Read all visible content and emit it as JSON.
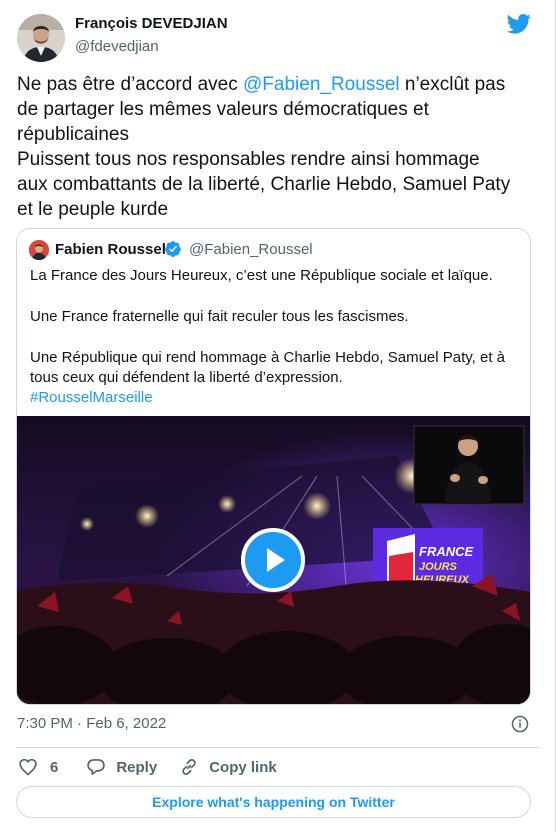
{
  "author": {
    "name": "François DEVEDJIAN",
    "handle": "@fdevedjian"
  },
  "tweet": {
    "line1_before": "Ne pas être d’accord avec ",
    "mention": "@Fabien_Roussel",
    "line1_after": " n’exclût pas",
    "line2": "de partager les mêmes valeurs démocratiques et",
    "line3": "républicaines",
    "line4": "Puissent tous nos responsables rendre ainsi hommage",
    "line5": "aux combattants de la liberté, Charlie Hebdo, Samuel Paty",
    "line6": "et le peuple kurde"
  },
  "quote": {
    "name": "Fabien Roussel",
    "handle": "@Fabien_Roussel",
    "p1": "La France des Jours Heureux, c’est une République sociale et laïque.",
    "p2": "Une France fraternelle qui fait reculer tous les fascismes.",
    "p3a": "Une République qui rend hommage à Charlie Hebdo, Samuel Paty, et à",
    "p3b": "tous ceux qui défendent la liberté d’expression.",
    "p3c": "#RousselMarseille",
    "video": {
      "stage_text_1": "FRANCE",
      "stage_text_2": "JOURS",
      "stage_text_3": "HEUREUX"
    }
  },
  "meta": {
    "timestamp": "7:30 PM · Feb 6, 2022"
  },
  "actions": {
    "like_count": "6",
    "reply_label": "Reply",
    "copy_link_label": "Copy link"
  },
  "explore_label": "Explore what's happening on Twitter",
  "colors": {
    "accent": "#1d9bf0",
    "secondary_text": "#536471",
    "border": "#cfd9de"
  },
  "icons": [
    "twitter-bird-icon",
    "verified-badge-icon",
    "play-icon",
    "info-icon",
    "heart-icon",
    "reply-icon",
    "link-icon"
  ]
}
